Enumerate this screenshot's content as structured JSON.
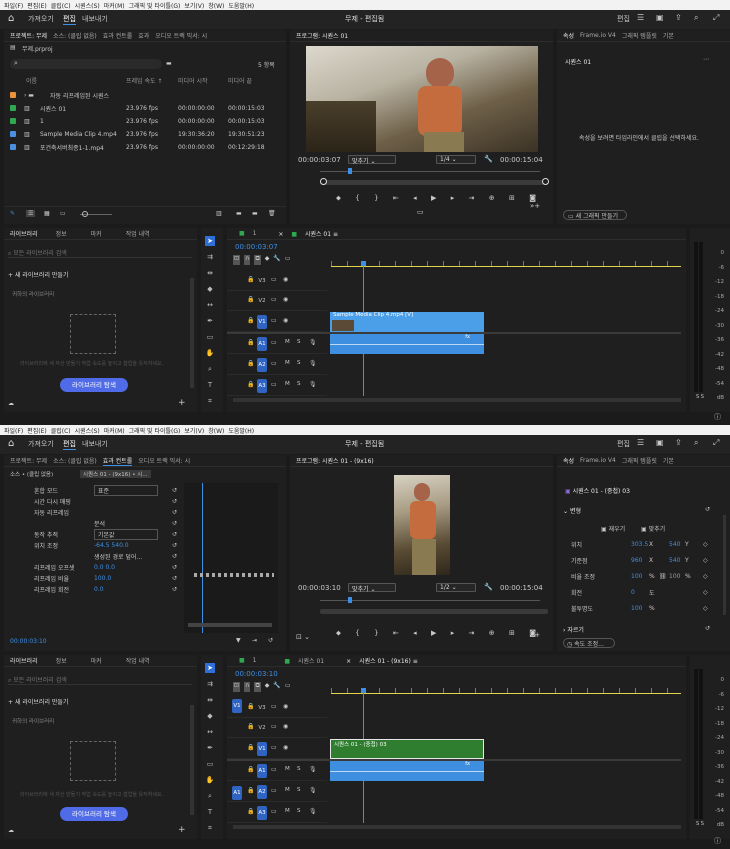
{
  "menu": [
    "파일(F)",
    "편집(E)",
    "클립(C)",
    "시퀀스(S)",
    "마커(M)",
    "그래픽 및 타이틀(G)",
    "보기(V)",
    "창(W)",
    "도움말(H)"
  ],
  "header": {
    "nav": [
      "가져오기",
      "편집",
      "내보내기"
    ],
    "title": "무제 - 편집됨",
    "mode": "편집"
  },
  "top": {
    "project_tabs": [
      "프로젝트: 무제",
      "소스: (클립 없음)",
      "효과 컨트롤",
      "효과",
      "오디오 트랙 믹서: 시"
    ],
    "project_file": "무제.prproj",
    "item_count": "5 항목",
    "columns": [
      "이름",
      "프레임 속도 ↑",
      "미디어 시작",
      "미디어 끝"
    ],
    "items": [
      {
        "name": "자동 리프레임된 시퀀스",
        "fps": "",
        "start": "",
        "end": "",
        "color": "#e8923a"
      },
      {
        "name": "시퀀스 01",
        "fps": "23.976 fps",
        "start": "00:00:00:00",
        "end": "00:00:15:03",
        "color": "#2fa84f"
      },
      {
        "name": "1",
        "fps": "23.976 fps",
        "start": "00:00:00:00",
        "end": "00:00:15:03",
        "color": "#2fa84f"
      },
      {
        "name": "Sample Media Clip 4.mp4",
        "fps": "23.976 fps",
        "start": "19:30:36:20",
        "end": "19:30:51:23",
        "color": "#4a8fe0"
      },
      {
        "name": "포건축서버최종1-1.mp4",
        "fps": "23.976 fps",
        "start": "00:00:00:00",
        "end": "00:12:29:18",
        "color": "#4a8fe0"
      }
    ],
    "program_tab": "프로그램: 시퀀스 01",
    "timecode": "00:00:03:07",
    "fit": "맞추기",
    "quality": "1/4",
    "duration": "00:00:15:04",
    "props_tabs": [
      "속성",
      "Frame.io V4",
      "그래픽 템플릿",
      "기본"
    ],
    "props_title": "시퀀스 01",
    "props_hint": "속성을 보려면 타임라인에서 클립을 선택하세요.",
    "new_graphic": "새 그래픽 만들기",
    "lib_tabs": [
      "라이브러리",
      "정보",
      "마커",
      "작업 내역"
    ],
    "lib_search": "모든 라이브러리 검색",
    "lib_create": "새 라이브러리 만들기",
    "lib_mine": "귀하의 라이브러리",
    "lib_desc": "라이브러리에 새 자산 만들기 작업 속도를 높이고 협업을 유지하세요.",
    "lib_button": "라이브러리 탐색",
    "seq_tabs": [
      "1",
      "시퀀스 01"
    ],
    "seq_timecode": "00:00:03:07",
    "tracks": [
      "V3",
      "V2",
      "V1",
      "A1",
      "A2",
      "A3"
    ],
    "clip_video": "Sample Media Clip 4.mp4 [V]",
    "clip_audio_tag": "fx",
    "meter_labels": [
      "0",
      "-6",
      "-12",
      "-18",
      "-24",
      "-30",
      "-36",
      "-42",
      "-48",
      "-54",
      "dB"
    ],
    "meter_ss": "S  S"
  },
  "bottom": {
    "left_tabs": [
      "프로젝트: 무제",
      "소스: (클립 없음)",
      "효과 컨트롤",
      "오디오 트랙 믹서: 시"
    ],
    "ec_source": "소스 • (클립 없음)",
    "ec_seq": "시퀀스 01 - (9x16) • 시...",
    "ec_rows": [
      {
        "label": "혼합 모드",
        "value": "표준"
      },
      {
        "label": "시간 다시 매핑",
        "value": ""
      },
      {
        "label": "자동 리프레임",
        "value": ""
      },
      {
        "label": "",
        "value": "분석"
      },
      {
        "label": "동작 추적",
        "value": "기본값"
      },
      {
        "label": "위치 조정",
        "value": "-64.5   540.0"
      },
      {
        "label": "",
        "value": "생성된 경로 덮어..."
      },
      {
        "label": "리프레임 오프셋",
        "value": "0.0   0.0"
      },
      {
        "label": "리프레임 비율",
        "value": "100.0"
      },
      {
        "label": "리프레임 회전",
        "value": "0.0"
      }
    ],
    "ec_timecode": "00:00:03:10",
    "program_tab": "프로그램: 시퀀스 01 - (9x16)",
    "timecode": "00:00:03:10",
    "fit": "맞추기",
    "quality": "1/2",
    "duration": "00:00:15:04",
    "props_tabs": [
      "속성",
      "Frame.io V4",
      "그래픽 템플릿",
      "기본"
    ],
    "props_title": "시퀀스 01 - (중첩) 03",
    "transform": "변형",
    "flip": [
      "재우기",
      "맞추기"
    ],
    "props_rows": [
      {
        "label": "위치",
        "v1": "303.5",
        "u1": "X",
        "v2": "540",
        "u2": "Y"
      },
      {
        "label": "기준점",
        "v1": "960",
        "u1": "X",
        "v2": "540",
        "u2": "Y"
      },
      {
        "label": "비율 조정",
        "v1": "100",
        "u1": "%",
        "v2": "100",
        "u2": "%"
      },
      {
        "label": "회전",
        "v1": "0",
        "u1": "도",
        "v2": "",
        "u2": ""
      },
      {
        "label": "불투명도",
        "v1": "100",
        "u1": "%",
        "v2": "",
        "u2": ""
      }
    ],
    "crop": "자르기",
    "speed": "속도 조정...",
    "lib_tabs": [
      "라이브러리",
      "정보",
      "마커",
      "작업 내역"
    ],
    "lib_search": "모든 라이브러리 검색",
    "lib_create": "새 라이브러리 만들기",
    "lib_mine": "귀하의 라이브러리",
    "lib_desc": "라이브러리에 새 자산 만들기 작업 속도를 높이고 협업을 유지하세요.",
    "lib_button": "라이브러리 탐색",
    "seq_tabs": [
      "1",
      "시퀀스 01",
      "시퀀스 01 - (9x16)"
    ],
    "seq_timecode": "00:00:03:10",
    "tracks": [
      "V3",
      "V2",
      "V1",
      "A1",
      "A2",
      "A3"
    ],
    "clip_video": "시퀀스 01 - (중첩) 03",
    "clip_audio_tag": "fx",
    "meter_labels": [
      "0",
      "-6",
      "-12",
      "-18",
      "-24",
      "-30",
      "-36",
      "-42",
      "-48",
      "-54",
      "dB"
    ],
    "meter_ss": "S  S"
  }
}
